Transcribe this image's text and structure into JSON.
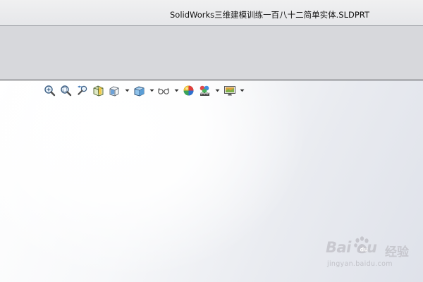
{
  "window": {
    "title": "SolidWorks三维建模训练一百八十二简单实体.SLDPRT"
  },
  "toolbar": {
    "buttons": [
      {
        "icon": "zoom-to-fit-icon"
      },
      {
        "icon": "zoom-to-area-icon"
      },
      {
        "icon": "previous-view-icon"
      },
      {
        "icon": "section-view-icon"
      },
      {
        "icon": "view-orientation-icon",
        "has_dropdown": true
      },
      {
        "icon": "display-style-icon",
        "has_dropdown": true
      },
      {
        "icon": "hide-show-items-icon",
        "has_dropdown": true
      },
      {
        "icon": "edit-appearance-icon"
      },
      {
        "icon": "apply-scene-icon",
        "has_dropdown": true
      },
      {
        "icon": "view-settings-icon",
        "has_dropdown": true
      }
    ]
  },
  "watermark": {
    "brand_left": "Bai",
    "brand_right": "u",
    "brand_cn": "经验",
    "url": "jingyan.baidu.com"
  },
  "colors": {
    "title_bar": "#ebebee",
    "ribbon": "#d7d8dc",
    "viewport_light": "#ffffff",
    "viewport_dark": "#dfe2ea"
  }
}
